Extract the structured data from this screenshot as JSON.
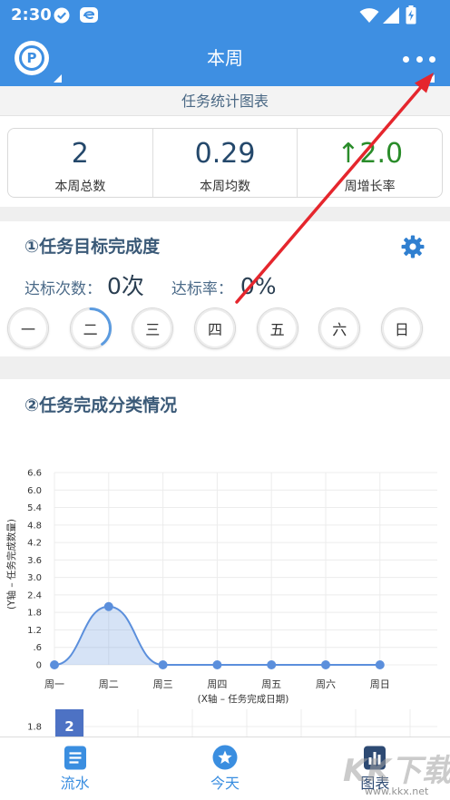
{
  "status_bar": {
    "time": "2:30"
  },
  "app_bar": {
    "logo_letter": "P",
    "title": "本周"
  },
  "section_header": {
    "title": "任务统计图表"
  },
  "stats": [
    {
      "value": "2",
      "label": "本周总数"
    },
    {
      "value": "0.29",
      "label": "本周均数"
    },
    {
      "arrow": "↑",
      "value": "2.0",
      "label": "周增长率"
    }
  ],
  "goal": {
    "title": "①任务目标完成度",
    "met_count_label": "达标次数：",
    "met_count_value": "0次",
    "met_rate_label": "达标率：",
    "met_rate_value": "0%",
    "days": [
      {
        "label": "一",
        "progress": 0
      },
      {
        "label": "二",
        "progress": 0.4
      },
      {
        "label": "三",
        "progress": 0
      },
      {
        "label": "四",
        "progress": 0
      },
      {
        "label": "五",
        "progress": 0
      },
      {
        "label": "六",
        "progress": 0
      },
      {
        "label": "日",
        "progress": 0
      }
    ]
  },
  "category": {
    "title": "②任务完成分类情况"
  },
  "chart_data": [
    {
      "type": "line",
      "categories": [
        "周一",
        "周二",
        "周三",
        "周四",
        "周五",
        "周六",
        "周日"
      ],
      "values": [
        0,
        2,
        0,
        0,
        0,
        0,
        0
      ],
      "xlabel": "(X轴 – 任务完成日期)",
      "ylabel": "(Y轴 – 任务完成数量)",
      "y_tick_labels": [
        "0",
        ".6",
        "1.2",
        "1.8",
        "2.4",
        "3.0",
        "3.6",
        "4.2",
        "4.8",
        "5.4",
        "6.0",
        "6.6"
      ],
      "ylim": [
        0,
        6.6
      ],
      "grid": true,
      "filled": true,
      "smooth": true
    },
    {
      "type": "bar",
      "values": [
        2
      ],
      "data_labels": [
        "2"
      ],
      "y_tick_labels": [
        "1.8"
      ],
      "grid": true
    }
  ],
  "bottom_nav": {
    "items": [
      {
        "label": "流水",
        "icon": "list-icon",
        "selected": false
      },
      {
        "label": "今天",
        "icon": "star-icon",
        "selected": false
      },
      {
        "label": "图表",
        "icon": "bar-chart-icon",
        "selected": true
      }
    ]
  },
  "watermark": {
    "text": "KK下载",
    "url": "www.kkx.net"
  },
  "icons": {
    "status": [
      "check-circle-icon",
      "app-notification-icon",
      "wifi-icon",
      "signal-icon",
      "battery-icon"
    ],
    "app_bar_right": "more-icon",
    "goal_settings": "gear-icon"
  },
  "colors": {
    "primary": "#3e8fe2",
    "value_text": "#24486b",
    "growth": "#2a8c2a",
    "series": "#5b8fdc",
    "bar": "#4d72c4",
    "annotation": "#e5262d",
    "page_background": "#efefef"
  }
}
